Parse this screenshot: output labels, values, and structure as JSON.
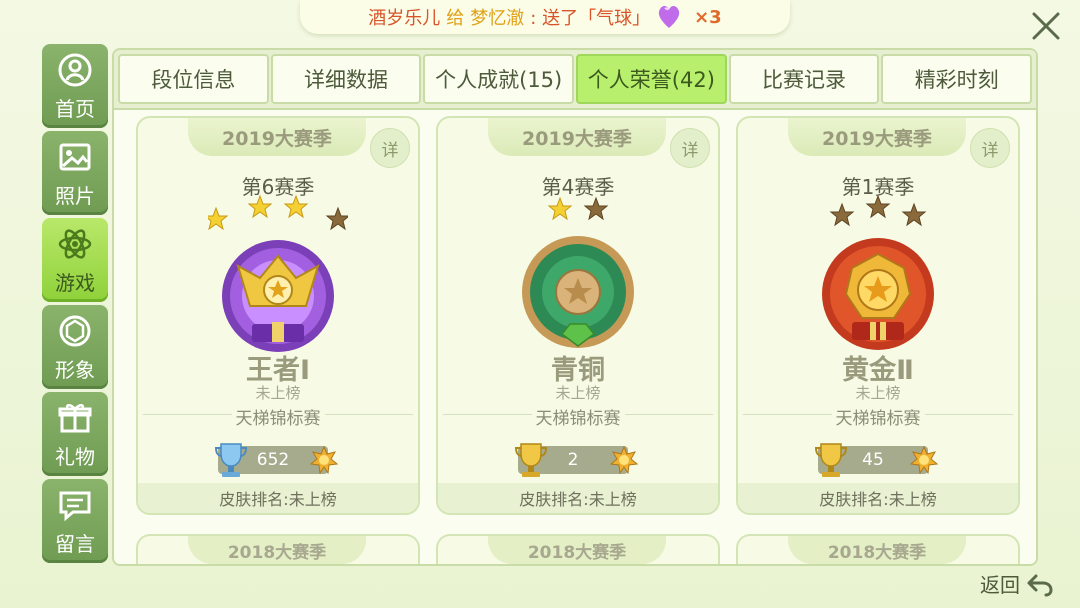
{
  "banner": {
    "sender": "酒岁乐儿",
    "gives": "给",
    "recipient": "梦忆澈",
    "action": ": 送了「气球」",
    "count": "×3"
  },
  "sidebar": [
    {
      "label": "首页",
      "icon": "home-icon"
    },
    {
      "label": "照片",
      "icon": "photo-icon"
    },
    {
      "label": "游戏",
      "icon": "game-icon",
      "active": true
    },
    {
      "label": "形象",
      "icon": "appearance-icon"
    },
    {
      "label": "礼物",
      "icon": "gift-icon"
    },
    {
      "label": "留言",
      "icon": "message-icon"
    }
  ],
  "tabs": [
    {
      "label": "段位信息"
    },
    {
      "label": "详细数据"
    },
    {
      "label": "个人成就(15)"
    },
    {
      "label": "个人荣誉(42)",
      "active": true
    },
    {
      "label": "比赛记录"
    },
    {
      "label": "精彩时刻"
    }
  ],
  "cards": [
    {
      "season_year": "2019大赛季",
      "season": "第6赛季",
      "rank": "王者Ⅰ",
      "leaderboard": "未上榜",
      "tournament": "天梯锦标赛",
      "score": "652",
      "skin_rank": "皮肤排名:未上榜",
      "detail": "详",
      "stars_lit": 3,
      "stars_total": 4,
      "medal": "king"
    },
    {
      "season_year": "2019大赛季",
      "season": "第4赛季",
      "rank": "青铜",
      "leaderboard": "未上榜",
      "tournament": "天梯锦标赛",
      "score": "2",
      "skin_rank": "皮肤排名:未上榜",
      "detail": "详",
      "stars_lit": 1,
      "stars_total": 2,
      "medal": "bronze"
    },
    {
      "season_year": "2019大赛季",
      "season": "第1赛季",
      "rank": "黄金Ⅱ",
      "leaderboard": "未上榜",
      "tournament": "天梯锦标赛",
      "score": "45",
      "skin_rank": "皮肤排名:未上榜",
      "detail": "详",
      "stars_lit": 0,
      "stars_total": 3,
      "medal": "gold"
    }
  ],
  "next_row": [
    "2018大赛季",
    "2018大赛季",
    "2018大赛季"
  ],
  "back_label": "返回",
  "colors": {
    "accent_green": "#b8ef6c",
    "sidebar_green": "#7aa65c",
    "rank_text": "#9a9b7d"
  }
}
